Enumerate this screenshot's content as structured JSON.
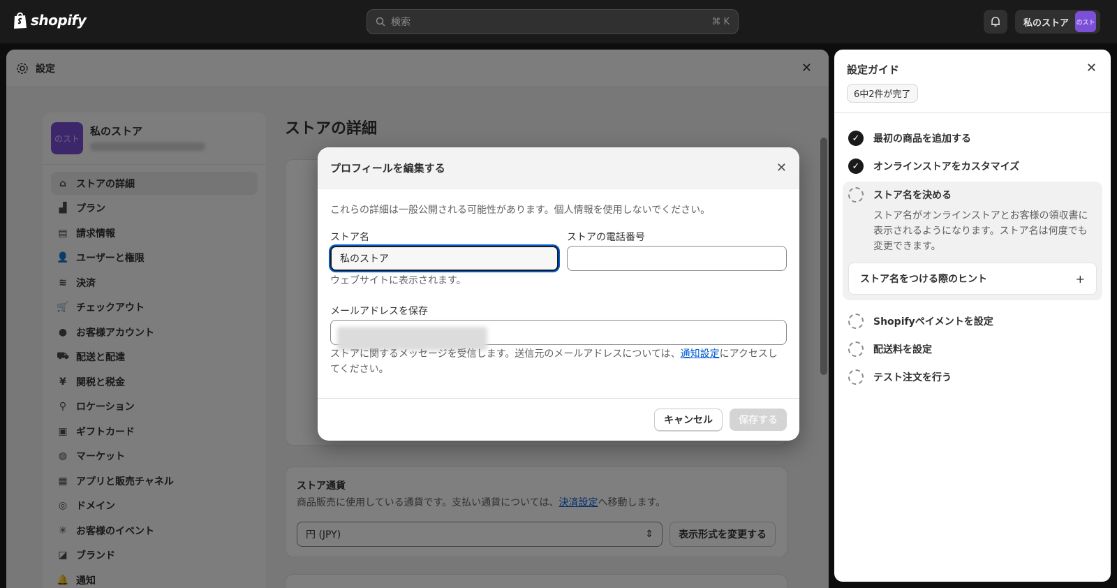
{
  "topbar": {
    "logo_text": "shopify",
    "search_placeholder": "検索",
    "search_shortcut": "⌘ K",
    "store_name": "私のストア",
    "avatar_text": "のスト"
  },
  "settings": {
    "title": "設定",
    "sidebar": {
      "store_name": "私のストア",
      "avatar_text": "のスト",
      "items": [
        {
          "label": "ストアの詳細",
          "icon": "store-icon"
        },
        {
          "label": "プラン",
          "icon": "plan-icon"
        },
        {
          "label": "請求情報",
          "icon": "billing-icon"
        },
        {
          "label": "ユーザーと権限",
          "icon": "users-icon"
        },
        {
          "label": "決済",
          "icon": "payments-icon"
        },
        {
          "label": "チェックアウト",
          "icon": "cart-icon"
        },
        {
          "label": "お客様アカウント",
          "icon": "person-icon"
        },
        {
          "label": "配送と配達",
          "icon": "truck-icon"
        },
        {
          "label": "関税と税金",
          "icon": "tax-icon"
        },
        {
          "label": "ロケーション",
          "icon": "location-icon"
        },
        {
          "label": "ギフトカード",
          "icon": "gift-card-icon"
        },
        {
          "label": "マーケット",
          "icon": "globe-icon"
        },
        {
          "label": "アプリと販売チャネル",
          "icon": "apps-icon"
        },
        {
          "label": "ドメイン",
          "icon": "domain-icon"
        },
        {
          "label": "お客様のイベント",
          "icon": "events-icon"
        },
        {
          "label": "ブランド",
          "icon": "brand-icon"
        },
        {
          "label": "通知",
          "icon": "bell-icon"
        }
      ]
    },
    "main_title": "ストアの詳細",
    "currency_card": {
      "title": "ストア通貨",
      "desc_pre": "商品販売に使用している通貨です。支払い通貨については、",
      "desc_link": "決済設定",
      "desc_post": "へ移動します。",
      "select_value": "円 (JPY)",
      "format_button": "表示形式を変更する"
    }
  },
  "guide": {
    "title": "設定ガイド",
    "progress": "6中2件が完了",
    "steps_done": [
      "最初の商品を追加する",
      "オンラインストアをカスタマイズ"
    ],
    "open_step": {
      "title": "ストア名を決める",
      "desc": "ストア名がオンラインストアとお客様の領収書に表示されるようになります。ストア名は何度でも変更できます。",
      "tip": "ストア名をつける際のヒント",
      "tip_toggle": "+"
    },
    "steps_todo": [
      "Shopifyペイメントを設定",
      "配送料を設定",
      "テスト注文を行う"
    ]
  },
  "modal": {
    "title": "プロフィールを編集する",
    "intro": "これらの詳細は一般公開される可能性があります。個人情報を使用しないでください。",
    "store_name_label": "ストア名",
    "store_name_value": "私のストア",
    "store_name_help": "ウェブサイトに表示されます。",
    "phone_label": "ストアの電話番号",
    "phone_value": "",
    "email_label": "メールアドレスを保存",
    "email_help_pre": "ストアに関するメッセージを受信します。送信元のメールアドレスについては、",
    "email_help_link": "通知設定",
    "email_help_post": "にアクセスしてください。",
    "cancel_label": "キャンセル",
    "save_label": "保存する"
  }
}
